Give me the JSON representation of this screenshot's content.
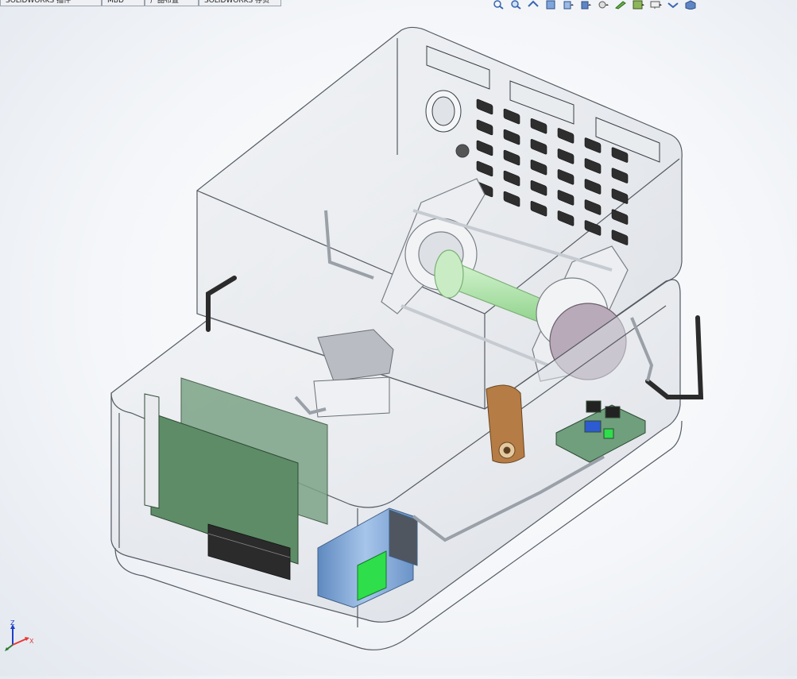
{
  "tabs": [
    {
      "label": "SOLIDWORKS 插件"
    },
    {
      "label": "MBD"
    },
    {
      "label": "产品布置"
    },
    {
      "label": "SOLIDWORKS 存货"
    }
  ],
  "toolbar_icons": [
    "zoom-to-fit-icon",
    "zoom-area-icon",
    "previous-view-icon",
    "section-view-icon",
    "view-orientation-icon",
    "display-style-icon",
    "hide-show-icon",
    "edit-appearance-icon",
    "apply-scene-icon",
    "view-settings-icon",
    "display-pane-icon",
    "view-cube-icon"
  ],
  "colors": {
    "housing_line": "#555b63",
    "housing_fill": "#dde1e6",
    "pcb_green": "#5f8f68",
    "tube_green": "#b6e8b3",
    "lcd_green": "#2ede4a",
    "capacitor_blue": "#7fa7d6",
    "terminal_black": "#2b2b2b",
    "orange_part": "#b57c45",
    "axis_x": "#e53935",
    "axis_y": "#2e7d32",
    "axis_z": "#1e40c8"
  },
  "triad": {
    "x": "X",
    "y": "Y",
    "z": "Z"
  }
}
